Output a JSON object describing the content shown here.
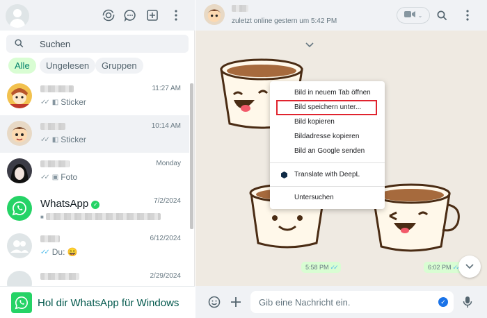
{
  "sidebar": {
    "search_placeholder": "Suchen",
    "filters": [
      "Alle",
      "Ungelesen",
      "Gruppen"
    ],
    "chats": [
      {
        "name": "",
        "time": "11:27 AM",
        "last": "Sticker"
      },
      {
        "name": "",
        "time": "10:14 AM",
        "last": "Sticker"
      },
      {
        "name": "",
        "time": "Monday",
        "last": "Foto"
      },
      {
        "name": "WhatsApp",
        "time": "7/2/2024",
        "last": ""
      },
      {
        "name": "",
        "time": "6/12/2024",
        "last": "Du: 😄"
      },
      {
        "name": "",
        "time": "2/29/2024",
        "last": ""
      }
    ],
    "promo": "Hol dir WhatsApp für Windows"
  },
  "conversation": {
    "status": "zuletzt online gestern um 5:42 PM",
    "times": [
      "5:58 PM",
      "6:02 PM"
    ],
    "composer_placeholder": "Gib eine Nachricht ein."
  },
  "context_menu": {
    "items": [
      "Bild in neuem Tab öffnen",
      "Bild speichern unter...",
      "Bild kopieren",
      "Bildadresse kopieren",
      "Bild an Google senden",
      "Translate with DeepL",
      "Untersuchen"
    ]
  },
  "colors": {
    "accent": "#25d366",
    "chip_active_bg": "#d9fdd3",
    "chip_active_text": "#008069",
    "highlight": "#e0232e",
    "chat_bg": "#efeae2"
  },
  "icons": [
    "status-icon",
    "channels-icon",
    "new-chat-icon",
    "menu-icon",
    "search-icon",
    "video-call-icon",
    "emoji-icon",
    "plus-icon",
    "mic-icon",
    "chevron-down-icon",
    "whatsapp-icon",
    "verified-icon",
    "deepl-icon"
  ]
}
